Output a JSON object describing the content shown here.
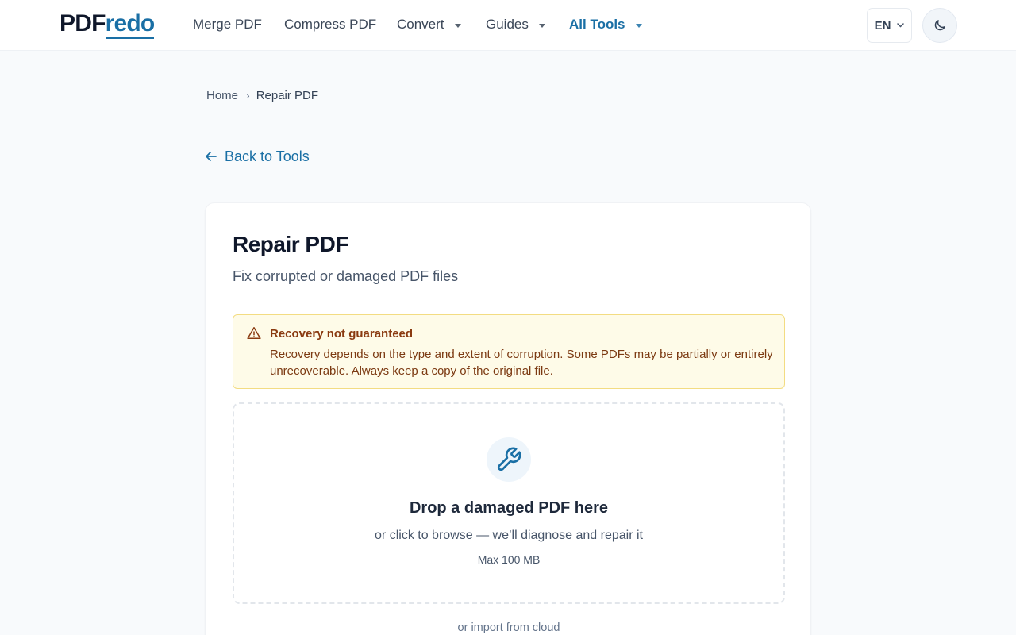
{
  "brand": {
    "name_part1": "PDF",
    "name_part2": "redo",
    "accent": "#1a6fa5"
  },
  "nav": {
    "items": [
      {
        "label": "Merge PDF",
        "dropdown": false
      },
      {
        "label": "Compress PDF",
        "dropdown": false
      },
      {
        "label": "Convert",
        "dropdown": true
      },
      {
        "label": "Guides",
        "dropdown": true
      },
      {
        "label": "All Tools",
        "dropdown": true,
        "active": true
      }
    ],
    "language": "EN",
    "theme_icon": "moon-icon"
  },
  "breadcrumb": {
    "home": "Home",
    "current": "Repair PDF"
  },
  "back_link": {
    "label": "Back to Tools",
    "icon": "arrow-left-icon"
  },
  "tool": {
    "title": "Repair PDF",
    "subtitle": "Fix corrupted or damaged PDF files",
    "alert": {
      "icon": "warning-triangle-icon",
      "title": "Recovery not guaranteed",
      "body": "Recovery depends on the type and extent of corruption. Some PDFs may be partially or entirely unrecoverable. Always keep a copy of the original file."
    },
    "dropzone": {
      "icon": "wrench-icon",
      "title": "Drop a damaged PDF here",
      "subtitle": "or click to browse — we’ll diagnose and repair it",
      "max_size": "Max 100 MB"
    },
    "cloud_import": "or import from cloud"
  }
}
